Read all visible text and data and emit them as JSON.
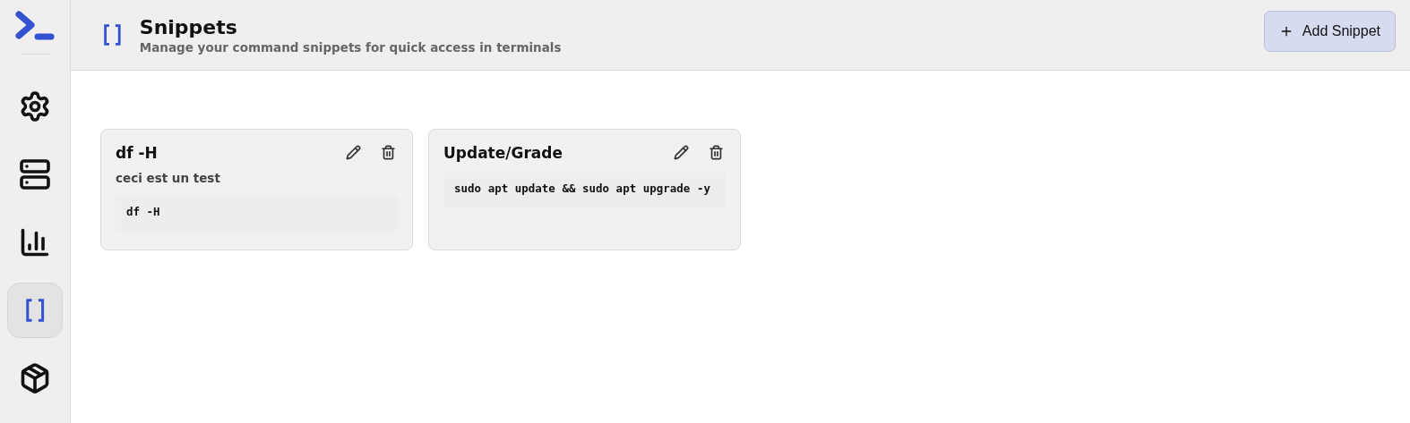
{
  "sidebar": {
    "items": [
      {
        "kind": "settings",
        "selected": false
      },
      {
        "kind": "servers",
        "selected": false
      },
      {
        "kind": "stats",
        "selected": false
      },
      {
        "kind": "snippets",
        "selected": true
      },
      {
        "kind": "packages",
        "selected": false
      }
    ]
  },
  "header": {
    "title": "Snippets",
    "subtitle": "Manage your command snippets for quick access in terminals",
    "add_button": "Add Snippet"
  },
  "snippets": [
    {
      "name": "df -H",
      "description": "ceci est un test",
      "command": "df -H"
    },
    {
      "name": "Update/Grade",
      "command": "sudo apt update && sudo apt upgrade -y"
    }
  ]
}
